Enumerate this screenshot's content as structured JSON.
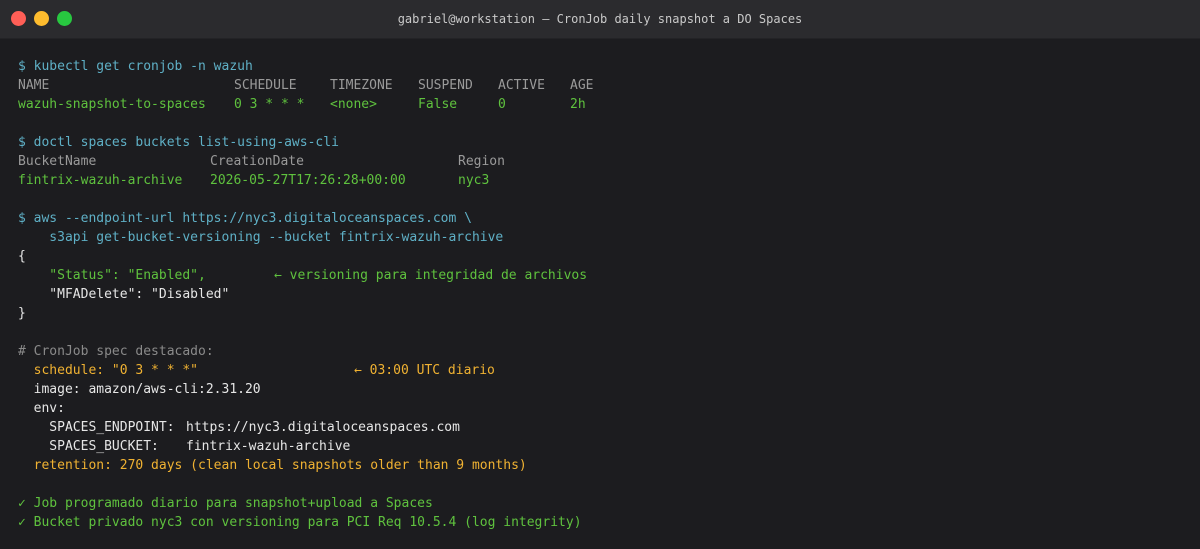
{
  "window": {
    "title": "gabriel@workstation — CronJob daily snapshot a DO Spaces",
    "colors": {
      "close": "#ff5f57",
      "minimize": "#febc2e",
      "zoom": "#28c840"
    }
  },
  "block1": {
    "command": "$ kubectl get cronjob -n wazuh",
    "headers": [
      "NAME",
      "SCHEDULE",
      "TIMEZONE",
      "SUSPEND",
      "ACTIVE",
      "AGE"
    ],
    "row": [
      "wazuh-snapshot-to-spaces",
      "0 3 * * *",
      "<none>",
      "False",
      "0",
      "2h"
    ]
  },
  "block2": {
    "command": "$ doctl spaces buckets list-using-aws-cli",
    "headers": [
      "BucketName",
      "CreationDate",
      "Region"
    ],
    "row": [
      "fintrix-wazuh-archive",
      "2026-05-27T17:26:28+00:00",
      "nyc3"
    ]
  },
  "block3": {
    "command1": "$ aws --endpoint-url https://nyc3.digitaloceanspaces.com \\",
    "command2": "    s3api get-bucket-versioning --bucket fintrix-wazuh-archive",
    "open_brace": "{",
    "status_line": "    \"Status\": \"Enabled\",",
    "status_note": "← versioning para integridad de archivos",
    "mfa_line": "    \"MFADelete\": \"Disabled\"",
    "close_brace": "}"
  },
  "block4": {
    "comment": "# CronJob spec destacado:",
    "schedule": "  schedule: \"0 3 * * *\"",
    "schedule_note": "← 03:00 UTC diario",
    "image": "  image: amazon/aws-cli:2.31.20",
    "env": "  env:",
    "endpoint_key": "    SPACES_ENDPOINT:",
    "endpoint_val": "https://nyc3.digitaloceanspaces.com",
    "bucket_key": "    SPACES_BUCKET:",
    "bucket_val": "fintrix-wazuh-archive",
    "retention": "  retention: 270 days (clean local snapshots older than 9 months)"
  },
  "summary": {
    "line1": "✓ Job programado diario para snapshot+upload a Spaces",
    "line2": "✓ Bucket privado nyc3 con versioning para PCI Req 10.5.4 (log integrity)"
  }
}
